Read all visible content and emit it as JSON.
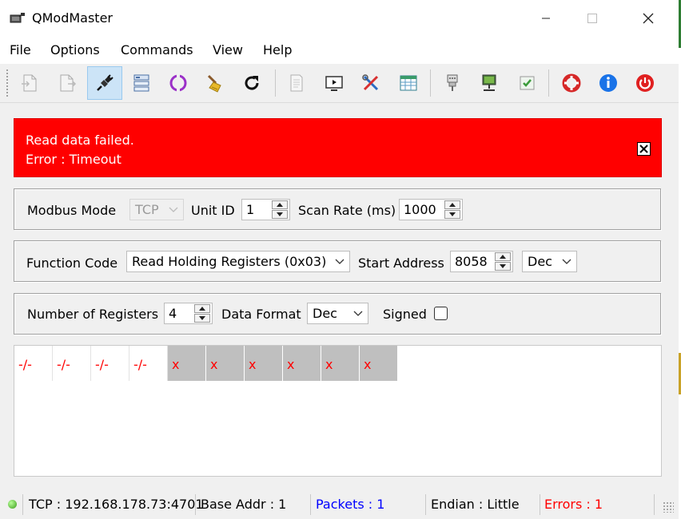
{
  "window": {
    "title": "QModMaster"
  },
  "menu": [
    "File",
    "Options",
    "Commands",
    "View",
    "Help"
  ],
  "toolbar": {
    "icons": [
      "load-session-icon",
      "save-session-icon",
      "connect-icon",
      "serial-rtu-icon",
      "tcp-icon",
      "clear-icon",
      "read-write-icon",
      "reset-counters-icon",
      "bus-monitor-icon",
      "tools-icon",
      "header-icon",
      "settings-icon",
      "ethernet-icon",
      "check-icon",
      "about-qt-icon",
      "about-icon",
      "exit-icon"
    ]
  },
  "error": {
    "line1": "Read data failed.",
    "line2": "Error : Timeout"
  },
  "modbus": {
    "mode_label": "Modbus Mode",
    "mode_value": "TCP",
    "unit_label": "Unit ID",
    "unit_value": "1",
    "scan_label": "Scan Rate (ms)",
    "scan_value": "1000"
  },
  "function": {
    "code_label": "Function Code",
    "code_value": "Read Holding Registers (0x03)",
    "start_label": "Start Address",
    "start_value": "8058",
    "base_value": "Dec"
  },
  "registers": {
    "count_label": "Number of Registers",
    "count_value": "4",
    "format_label": "Data Format",
    "format_value": "Dec",
    "signed_label": "Signed"
  },
  "cells": [
    "-/-",
    "-/-",
    "-/-",
    "-/-",
    "x",
    "x",
    "x",
    "x",
    "x",
    "x"
  ],
  "status": {
    "connection": "TCP : 192.168.178.73:4701",
    "base_addr": "Base Addr : 1",
    "packets": "Packets : 1",
    "endian": "Endian : Little",
    "errors": "Errors : 1"
  },
  "colors": {
    "error_bg": "#ff0000",
    "packets": "#0000ff",
    "errors": "#ff0000",
    "cell_error_bg": "#bfbfbf"
  }
}
